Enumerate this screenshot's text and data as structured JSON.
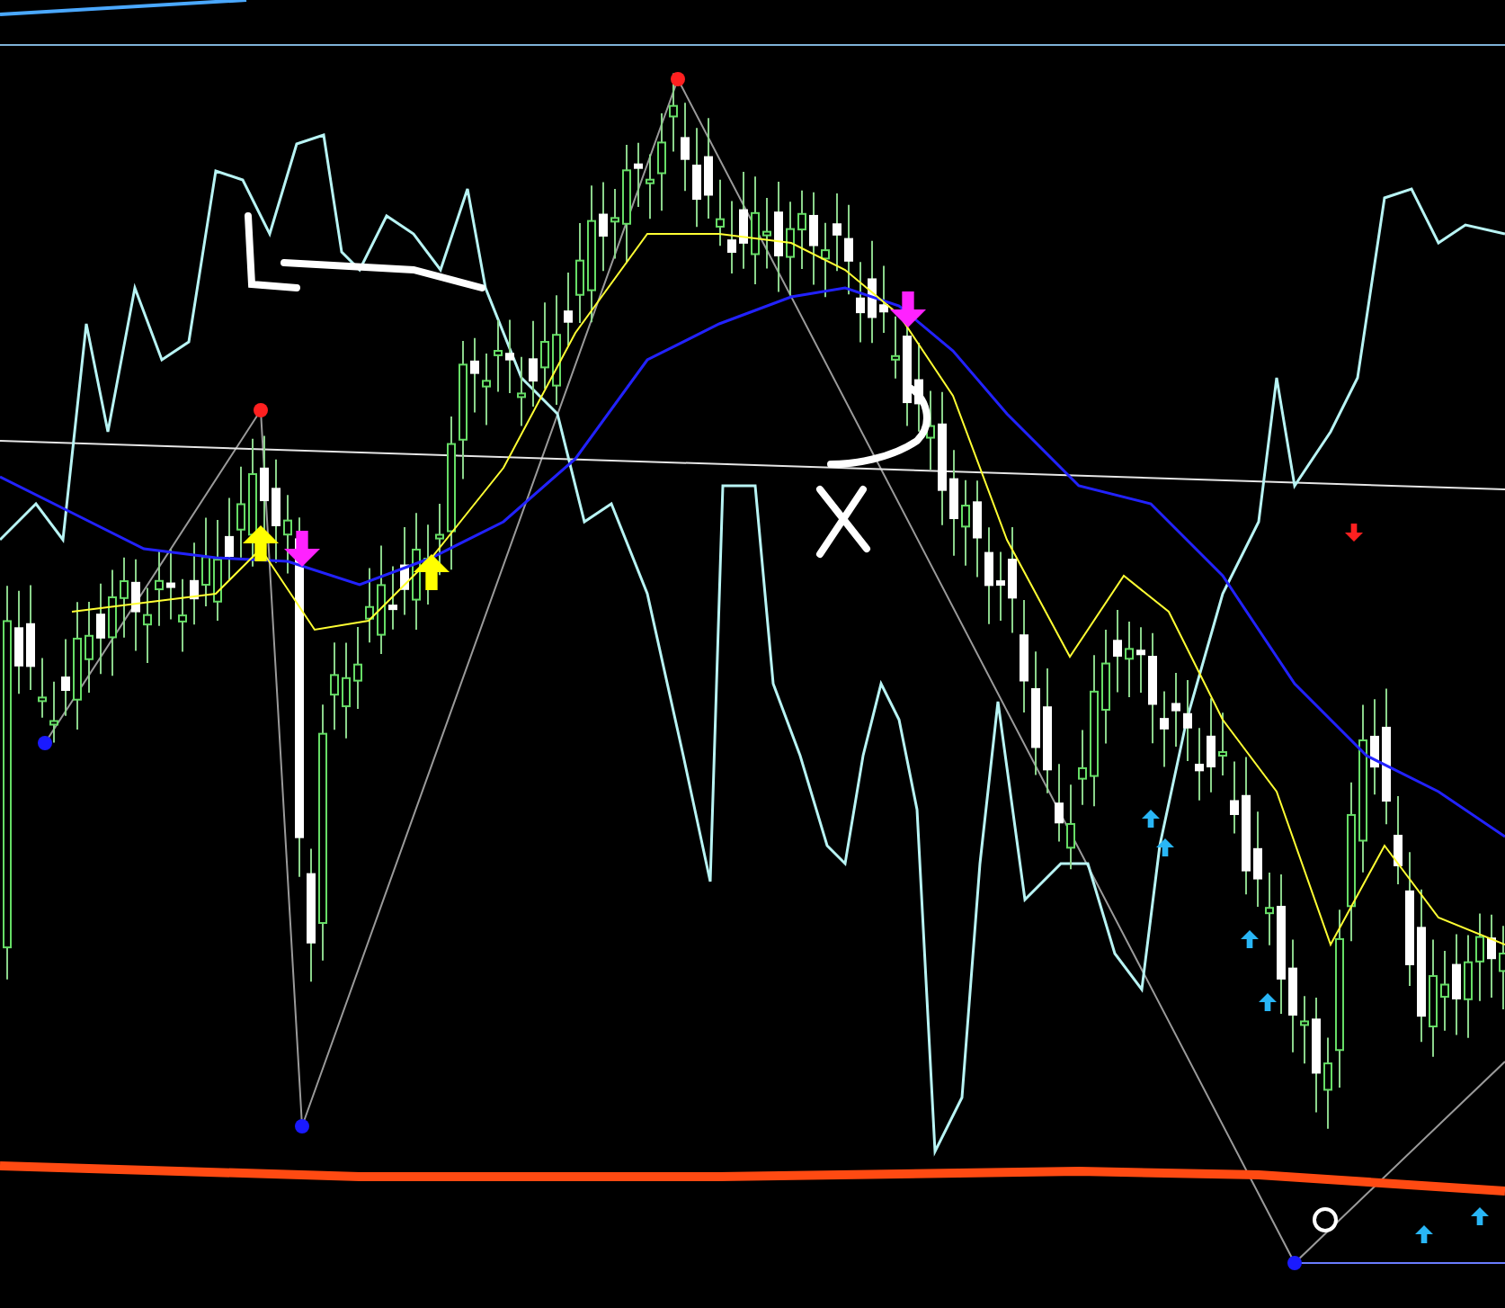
{
  "signals": [
    {
      "kind": "up",
      "color": "#ffff00"
    },
    {
      "kind": "up",
      "color": "#ffff00"
    },
    {
      "kind": "down",
      "color": "#ff22ff"
    },
    {
      "kind": "down",
      "color": "#ff22ff"
    },
    {
      "kind": "down",
      "color": "#ff2020"
    },
    {
      "kind": "up",
      "color": "#29b6f6"
    },
    {
      "kind": "up",
      "color": "#29b6f6"
    },
    {
      "kind": "up",
      "color": "#29b6f6"
    },
    {
      "kind": "up",
      "color": "#29b6f6"
    },
    {
      "kind": "up",
      "color": "#29b6f6"
    },
    {
      "kind": "up",
      "color": "#29b6f6"
    }
  ],
  "pivots": [
    {
      "color": "#1a1aff"
    },
    {
      "color": "#ff2020"
    },
    {
      "color": "#1a1aff"
    },
    {
      "color": "#ff2020"
    },
    {
      "color": "#1a1aff"
    }
  ]
}
